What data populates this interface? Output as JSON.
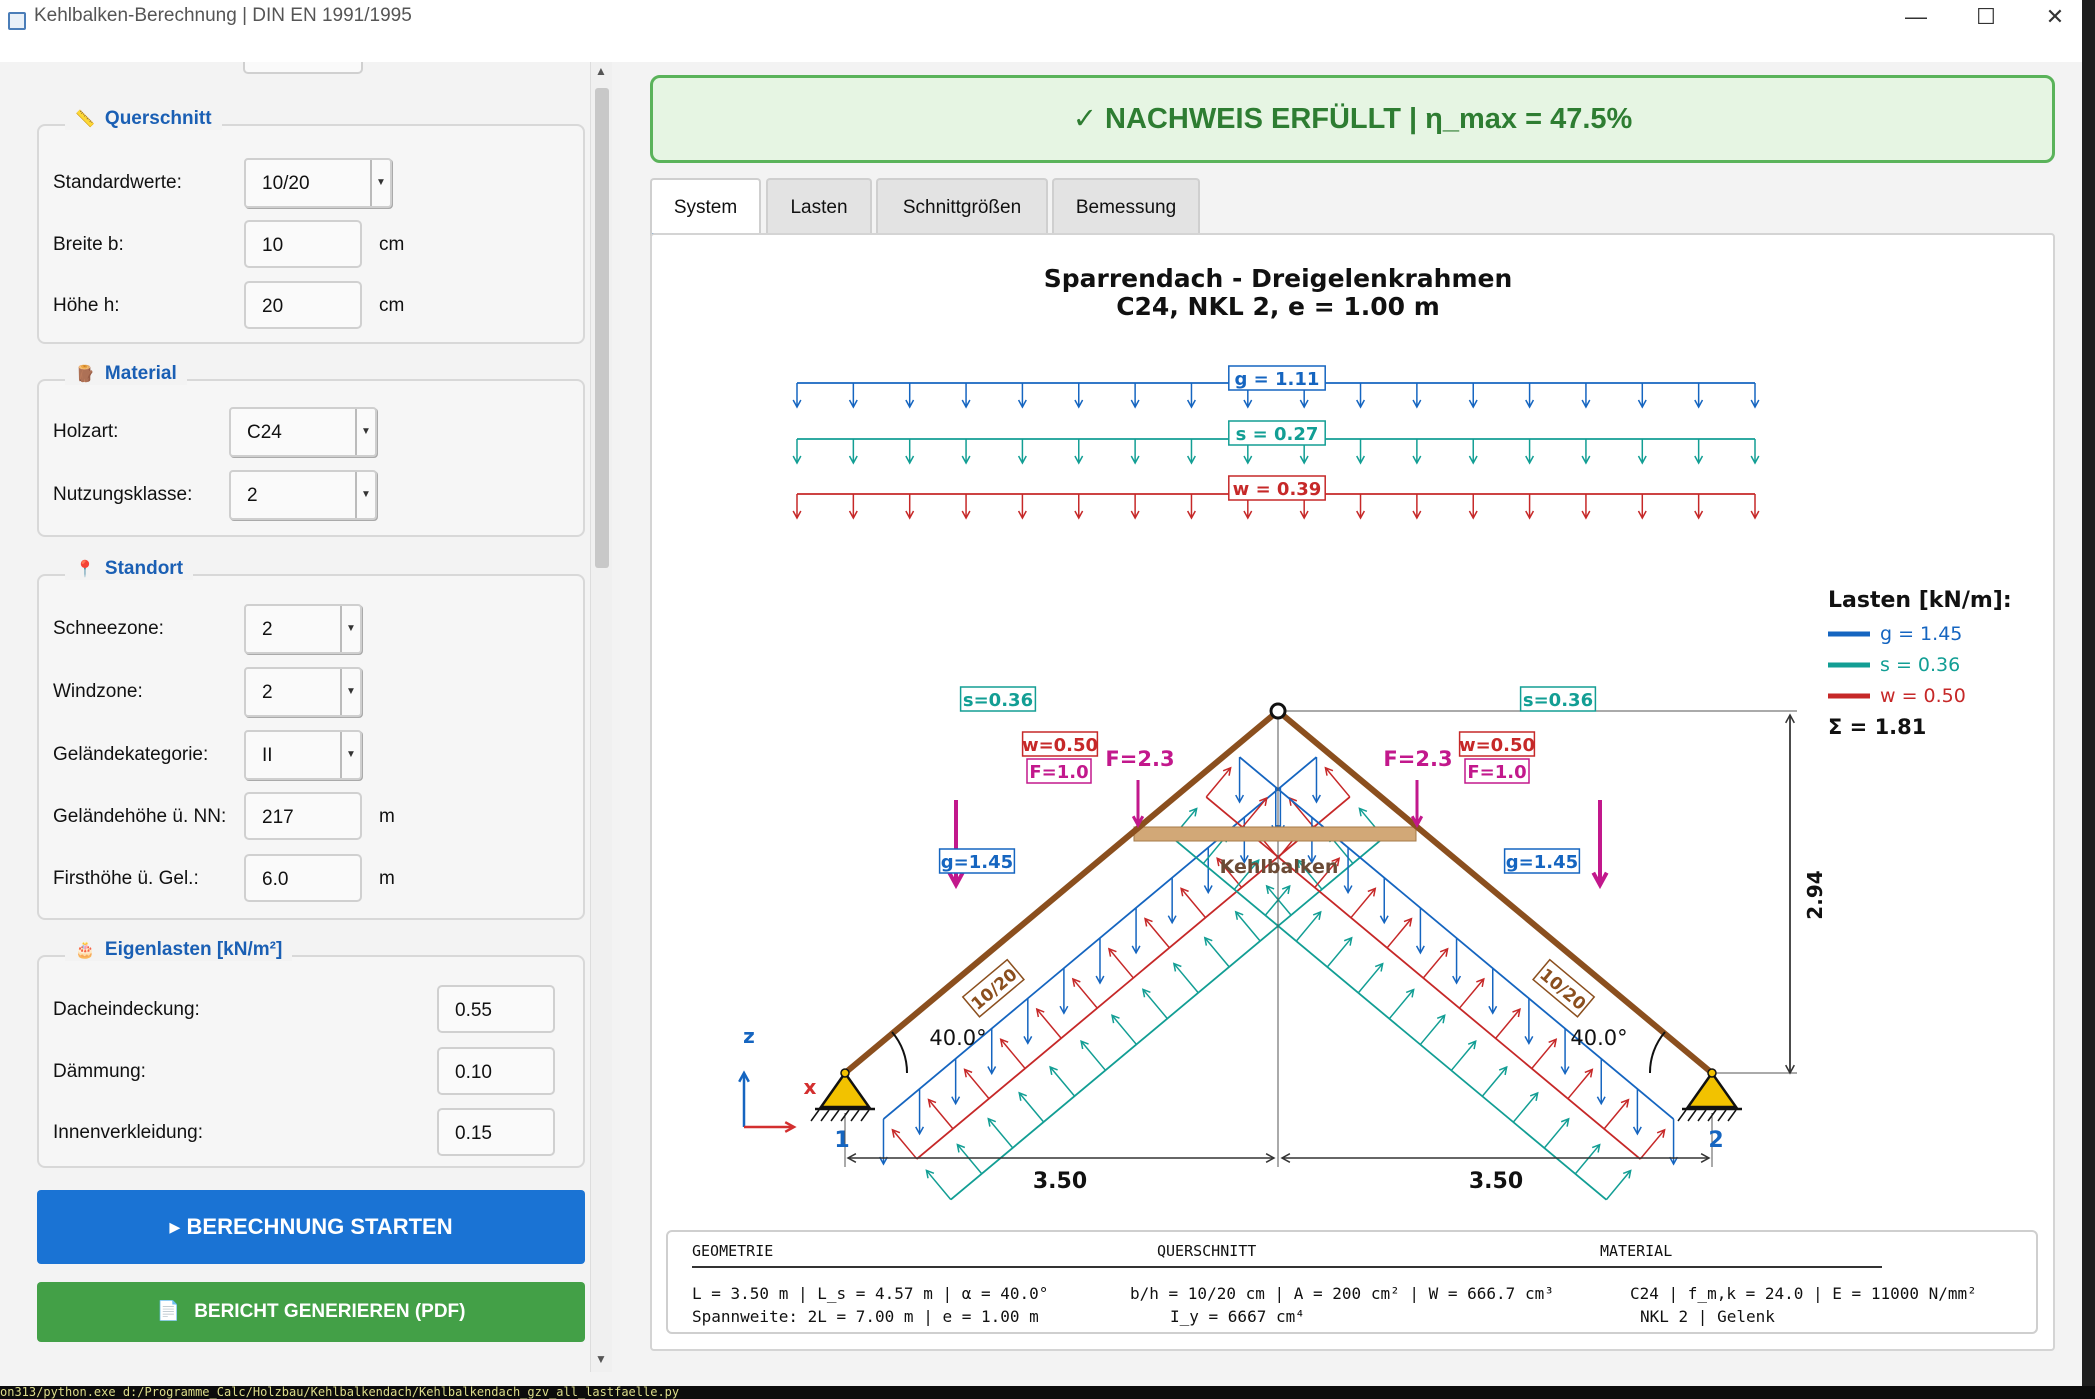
{
  "window": {
    "title": "Kehlbalken-Berechnung | DIN EN 1991/1995",
    "minimize": "—",
    "maximize": "☐",
    "close": "✕"
  },
  "sidebar": {
    "querschnitt": {
      "title": "Querschnitt",
      "standard_label": "Standardwerte:",
      "standard_value": "10/20",
      "b_label": "Breite b:",
      "b_value": "10",
      "b_unit": "cm",
      "h_label": "Höhe h:",
      "h_value": "20",
      "h_unit": "cm"
    },
    "material": {
      "title": "Material",
      "holzart_label": "Holzart:",
      "holzart_value": "C24",
      "nkl_label": "Nutzungsklasse:",
      "nkl_value": "2"
    },
    "standort": {
      "title": "Standort",
      "schnee_label": "Schneezone:",
      "schnee_value": "2",
      "wind_label": "Windzone:",
      "wind_value": "2",
      "gelkat_label": "Geländekategorie:",
      "gelkat_value": "II",
      "gelhoehe_label": "Geländehöhe ü. NN:",
      "gelhoehe_value": "217",
      "gelhoehe_unit": "m",
      "first_label": "Firsthöhe ü. Gel.:",
      "first_value": "6.0",
      "first_unit": "m"
    },
    "eigenlasten": {
      "title": "Eigenlasten [kN/m²]",
      "dach_label": "Dacheindeckung:",
      "dach_value": "0.55",
      "daemm_label": "Dämmung:",
      "daemm_value": "0.10",
      "innen_label": "Innenverkleidung:",
      "innen_value": "0.15"
    },
    "start_button": "▸  BERECHNUNG STARTEN",
    "report_button": "BERICHT GENERIEREN (PDF)",
    "colors": {
      "primary": "#1a73d4",
      "success": "#43a047",
      "accent": "#1a5fb4"
    }
  },
  "result": {
    "banner": "✓ NACHWEIS ERFÜLLT  |  η_max = 47.5%",
    "color": "#2e7d32"
  },
  "tabs": [
    "System",
    "Lasten",
    "Schnittgrößen",
    "Bemessung"
  ],
  "figure": {
    "title1": "Sparrendach - Dreigelenkrahmen",
    "title2": "C24, NKL 2, e = 1.00 m",
    "g_top": "g = 1.11",
    "s_top": "s = 0.27",
    "w_top": "w = 0.39",
    "s_side": "s=0.36",
    "w_side": "w=0.50",
    "f_label": "F=1.0",
    "f_big": "F=2.3",
    "g_side": "g=1.45",
    "kehlbalken": "Kehlbalken",
    "section": "10/20",
    "angle": "40.0°",
    "node1": "1",
    "node2": "2",
    "axis_z": "z",
    "axis_x": "x",
    "span_left": "3.50",
    "span_right": "3.50",
    "height": "2.94",
    "legend_title": "Lasten [kN/m]:",
    "legend_g": "g = 1.45",
    "legend_s": "s = 0.36",
    "legend_w": "w = 0.50",
    "legend_sum": "Σ = 1.81",
    "colors": {
      "g": "#1565c0",
      "s": "#129e94",
      "w": "#c62828",
      "f": "#c2188c",
      "rafter": "#8b4f1e",
      "beam": "#d2a877"
    }
  },
  "infobox": {
    "h1": "GEOMETRIE",
    "h2": "QUERSCHNITT",
    "h3": "MATERIAL",
    "geo1": "L = 3.50 m | L_s = 4.57 m | α = 40.0°",
    "geo2": "Spannweite: 2L = 7.00 m | e = 1.00 m",
    "qs1": "b/h = 10/20 cm | A = 200 cm² | W = 666.7 cm³",
    "qs2": "I_y = 6667 cm⁴",
    "mat1": "C24 | f_m,k = 24.0 | E = 11000 N/mm²",
    "mat2": "NKL 2 | Gelenk"
  },
  "terminal": "on313/python.exe d:/Programme_Calc/Holzbau/Kehlbalkendach/Kehlbalkendach_gzv_all_lastfaelle.py"
}
